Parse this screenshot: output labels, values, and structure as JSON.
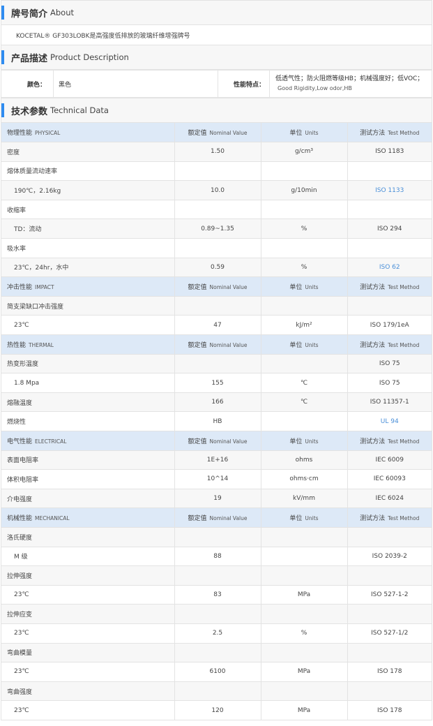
{
  "about": {
    "title_zh": "牌号简介",
    "title_en": "About",
    "text": "KOCETAL® GF303LOBK是高强度低排放的玻璃纤维增强牌号"
  },
  "product": {
    "title_zh": "产品描述",
    "title_en": "Product Description",
    "color_label": "颜色：",
    "color_value": "黑色",
    "features_label": "性能特点：",
    "features_zh": "低透气性；防火阻燃等级HB；机械强度好；低VOC；",
    "features_en": "Good Rigidity,Low odor,HB"
  },
  "tech": {
    "title_zh": "技术参数",
    "title_en": "Technical Data",
    "headers": {
      "value_zh": "额定值",
      "value_en": "Nominal Value",
      "unit_zh": "单位",
      "unit_en": "Units",
      "method_zh": "测试方法",
      "method_en": "Test Method"
    },
    "sections": [
      {
        "zh": "物理性能",
        "en": "PHYSICAL",
        "rows": [
          {
            "name": "密度",
            "value": "1.50",
            "unit": "g/cm³",
            "method": "ISO 1183",
            "sub": false,
            "link": false
          },
          {
            "name": "熔体质量流动速率",
            "value": "",
            "unit": "",
            "method": "",
            "sub": false,
            "link": false
          },
          {
            "name": "190℃，2.16kg",
            "value": "10.0",
            "unit": "g/10min",
            "method": "ISO 1133",
            "sub": true,
            "link": true
          },
          {
            "name": "收缩率",
            "value": "",
            "unit": "",
            "method": "",
            "sub": false,
            "link": false
          },
          {
            "name": "TD：流动",
            "value": "0.89~1.35",
            "unit": "%",
            "method": "ISO 294",
            "sub": true,
            "link": false
          },
          {
            "name": "吸水率",
            "value": "",
            "unit": "",
            "method": "",
            "sub": false,
            "link": false
          },
          {
            "name": "23℃，24hr，水中",
            "value": "0.59",
            "unit": "%",
            "method": "ISO 62",
            "sub": true,
            "link": true
          }
        ]
      },
      {
        "zh": "冲击性能",
        "en": "IMPACT",
        "rows": [
          {
            "name": "简支梁缺口冲击强度",
            "value": "",
            "unit": "",
            "method": "",
            "sub": false,
            "link": false
          },
          {
            "name": "23℃",
            "value": "47",
            "unit": "kJ/m²",
            "method": "ISO 179/1eA",
            "sub": true,
            "link": false
          }
        ]
      },
      {
        "zh": "热性能",
        "en": "THERMAL",
        "rows": [
          {
            "name": "热变形温度",
            "value": "",
            "unit": "",
            "method": "ISO 75",
            "sub": false,
            "link": false
          },
          {
            "name": "1.8 Mpa",
            "value": "155",
            "unit": "℃",
            "method": "ISO 75",
            "sub": true,
            "link": false
          },
          {
            "name": "熔融温度",
            "value": "166",
            "unit": "℃",
            "method": "ISO 11357-1",
            "sub": false,
            "link": false
          },
          {
            "name": "燃烧性",
            "value": "HB",
            "unit": "",
            "method": "UL 94",
            "sub": false,
            "link": true
          }
        ]
      },
      {
        "zh": "电气性能",
        "en": "ELECTRICAL",
        "rows": [
          {
            "name": "表面电阻率",
            "value": "1E+16",
            "unit": "ohms",
            "method": "IEC 6009",
            "sub": false,
            "link": false
          },
          {
            "name": "体积电阻率",
            "value": "10^14",
            "unit": "ohms·cm",
            "method": "IEC 60093",
            "sub": false,
            "link": false
          },
          {
            "name": "介电强度",
            "value": "19",
            "unit": "kV/mm",
            "method": "IEC 6024",
            "sub": false,
            "link": false
          }
        ]
      },
      {
        "zh": "机械性能",
        "en": "MECHANICAL",
        "rows": [
          {
            "name": "洛氏硬度",
            "value": "",
            "unit": "",
            "method": "",
            "sub": false,
            "link": false
          },
          {
            "name": "M 级",
            "value": "88",
            "unit": "",
            "method": "ISO 2039-2",
            "sub": true,
            "link": false
          },
          {
            "name": "拉伸强度",
            "value": "",
            "unit": "",
            "method": "",
            "sub": false,
            "link": false
          },
          {
            "name": "23℃",
            "value": "83",
            "unit": "MPa",
            "method": "ISO 527-1-2",
            "sub": true,
            "link": false
          },
          {
            "name": "拉伸应变",
            "value": "",
            "unit": "",
            "method": "",
            "sub": false,
            "link": false
          },
          {
            "name": "23℃",
            "value": "2.5",
            "unit": "%",
            "method": "ISO 527-1/2",
            "sub": true,
            "link": false
          },
          {
            "name": "弯曲模量",
            "value": "",
            "unit": "",
            "method": "",
            "sub": false,
            "link": false
          },
          {
            "name": "23℃",
            "value": "6100",
            "unit": "MPa",
            "method": "ISO 178",
            "sub": true,
            "link": false
          },
          {
            "name": "弯曲强度",
            "value": "",
            "unit": "",
            "method": "",
            "sub": false,
            "link": false
          },
          {
            "name": "23℃",
            "value": "120",
            "unit": "MPa",
            "method": "ISO 178",
            "sub": true,
            "link": false
          }
        ]
      }
    ]
  },
  "colors": {
    "accent": "#2f8cf0",
    "category_bg": "#dde9f7",
    "alt_bg": "#f7f7f7",
    "link": "#4a8fd8"
  }
}
